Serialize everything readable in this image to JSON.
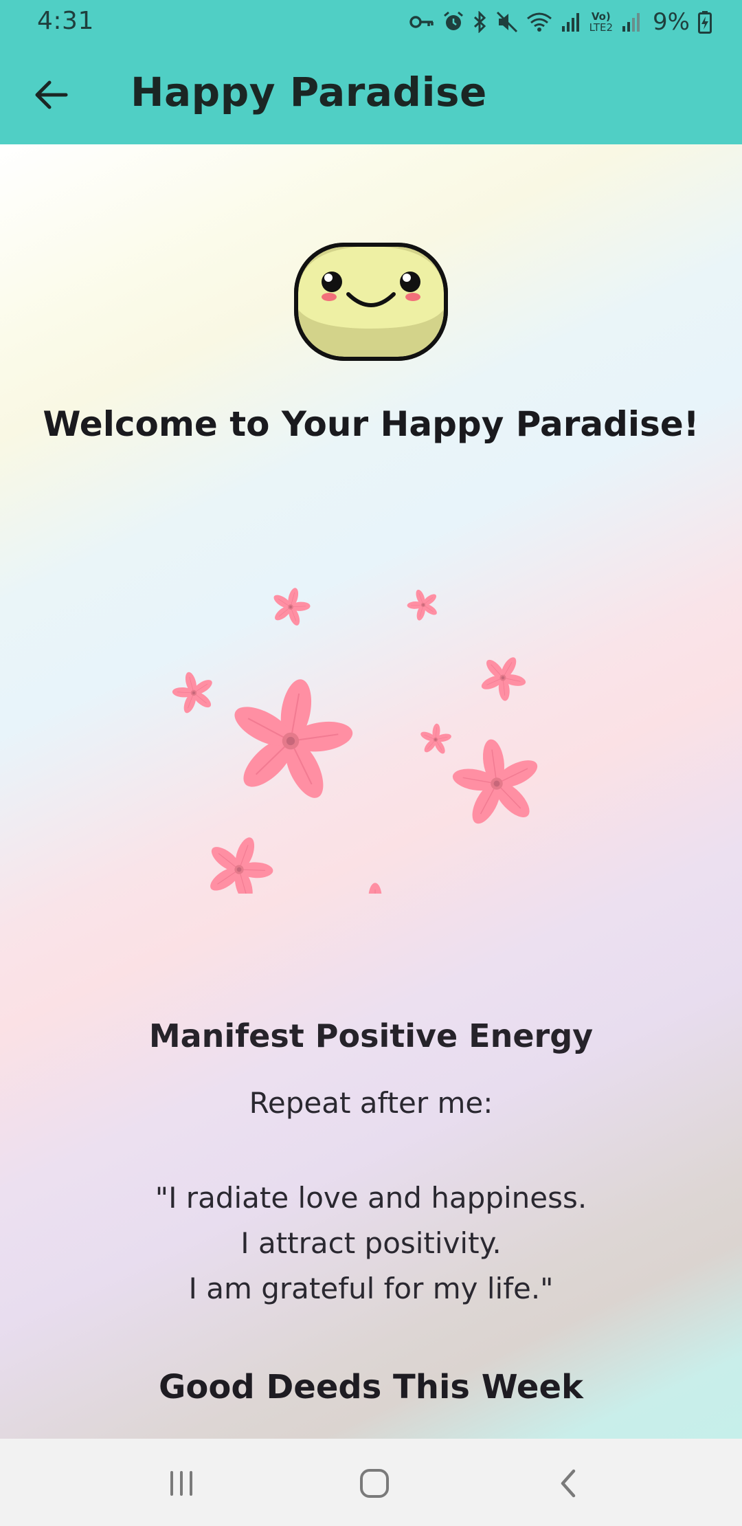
{
  "status_bar": {
    "time": "4:31",
    "battery_percent": "9%",
    "network_label": "LTE2",
    "icons": [
      "key-icon",
      "alarm-icon",
      "bluetooth-icon",
      "mute-icon",
      "wifi-icon",
      "signal-icon",
      "volte-icon",
      "signal-icon-2",
      "battery-charging-icon"
    ]
  },
  "app_bar": {
    "title": "Happy Paradise",
    "back_icon": "arrow-left-icon"
  },
  "main": {
    "mascot_icon": "smiling-face-icon",
    "welcome": "Welcome to Your Happy Paradise!",
    "decoration_icon": "flower-icon",
    "manifest_title": "Manifest Positive Energy",
    "repeat_prompt": "Repeat after me:",
    "affirmation_lines": [
      "\"I radiate love and happiness.",
      "I attract positivity.",
      "I am grateful for my life.\""
    ],
    "deeds_title": "Good Deeds This Week"
  },
  "nav_bar": {
    "recents_icon": "recents-icon",
    "home_icon": "home-icon",
    "back_icon": "back-chevron-icon"
  },
  "colors": {
    "app_bar": "#50cfc5",
    "flower": "#ff8fa3",
    "mascot": "#eef0a4",
    "nav_bar": "#f2f2f2"
  }
}
